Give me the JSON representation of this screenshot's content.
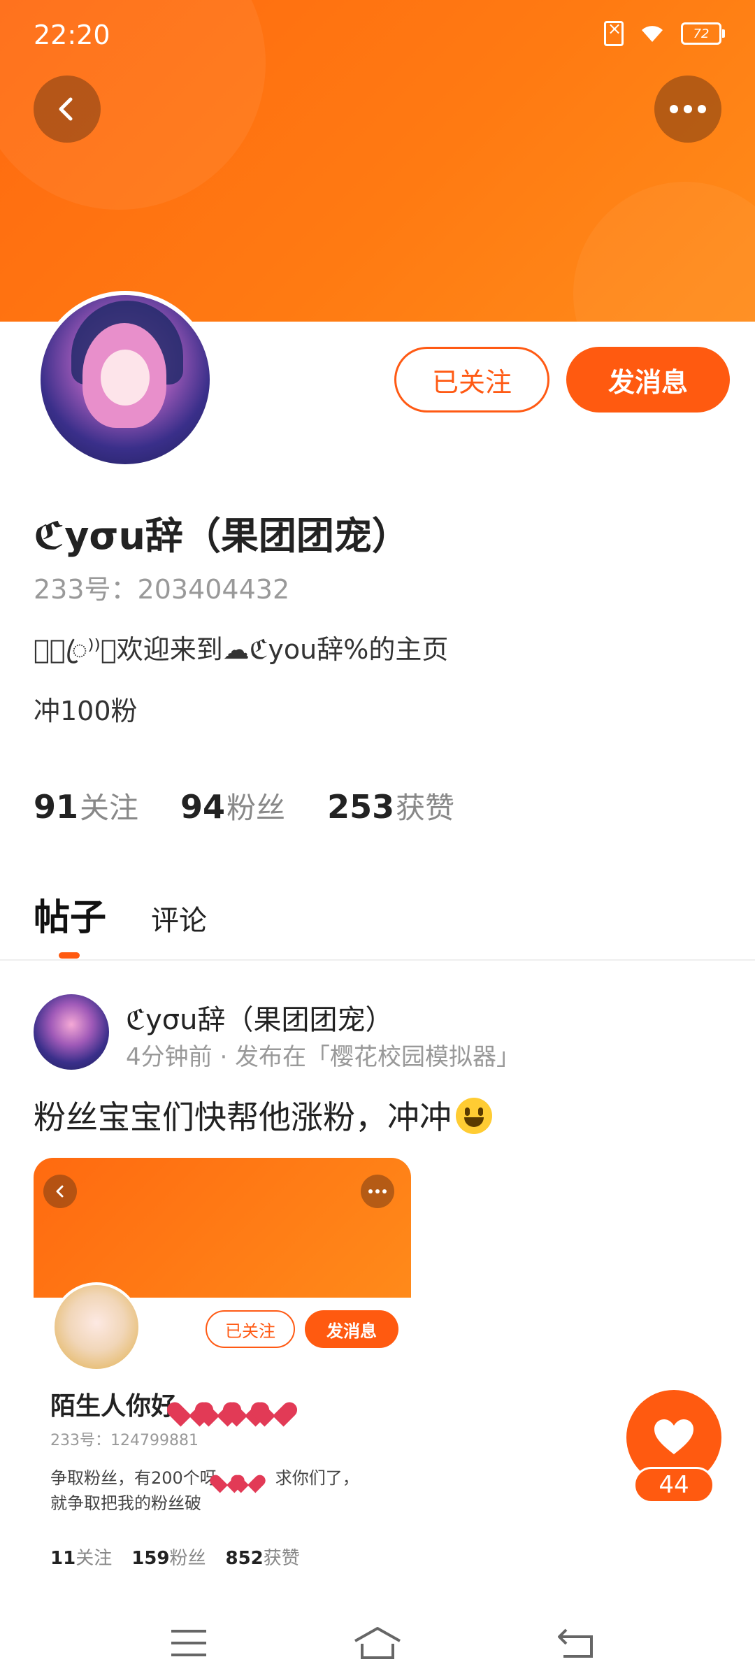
{
  "status_bar": {
    "time": "22:20",
    "battery": "72"
  },
  "profile": {
    "name": "ℭyσu辞（果团团宠）",
    "uid": "233号：203404432",
    "bio_line1": "⸙᭄ꦿ⁾⁾ꦿ欢迎来到☁ℭyou辞%的主页",
    "bio_line2": "冲100粉",
    "follow_button": "已关注",
    "message_button": "发消息",
    "stats": {
      "following_count": "91",
      "following_label": "关注",
      "fans_count": "94",
      "fans_label": "粉丝",
      "likes_count": "253",
      "likes_label": "获赞"
    }
  },
  "tabs": {
    "posts": "帖子",
    "comments": "评论"
  },
  "post": {
    "author": "ℭyσu辞（果团团宠）",
    "meta": "4分钟前 · 发布在「樱花校园模拟器」",
    "text": "粉丝宝宝们快帮他涨粉，冲冲",
    "embedded": {
      "follow_button": "已关注",
      "message_button": "发消息",
      "name": "陌生人你好",
      "uid": "233号：124799881",
      "bio_a": "争取粉丝，有200个呀",
      "bio_b": "，求你们了，",
      "bio_line2": "就争取把我的粉丝破",
      "following_count": "11",
      "following_label": "关注",
      "fans_count": "159",
      "fans_label": "粉丝",
      "likes_count": "852",
      "likes_label": "获赞"
    },
    "like_count": "44"
  },
  "icons": {
    "back": "chevron-left-icon",
    "more": "more-dots-icon",
    "heart": "heart-icon",
    "nav_menu": "menu-icon",
    "nav_home": "home-icon",
    "nav_back": "back-arrow-icon"
  },
  "colors": {
    "accent": "#ff5a10",
    "banner": "#ff7a12"
  }
}
